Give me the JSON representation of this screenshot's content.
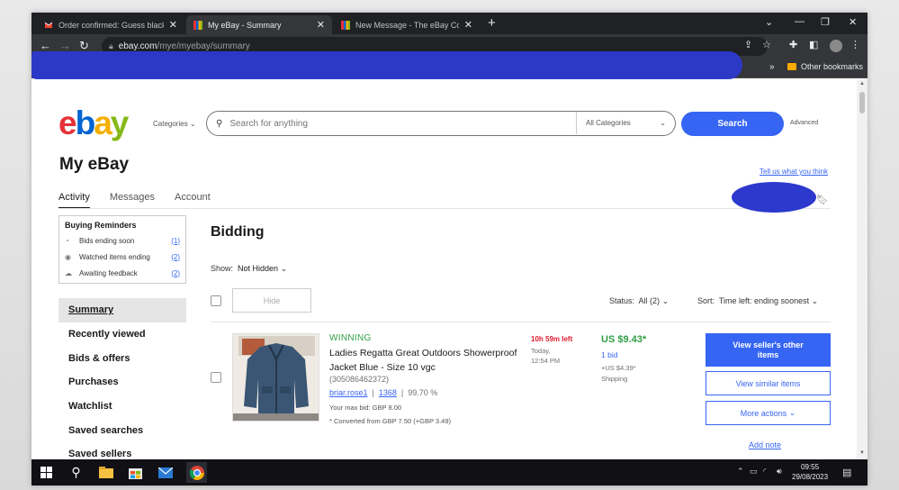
{
  "browser": {
    "tabs": [
      {
        "title": "Order confirmed: Guess black ba",
        "favicon": "gmail-icon",
        "active": false
      },
      {
        "title": "My eBay - Summary",
        "favicon": "ebay-icon",
        "active": true
      },
      {
        "title": "New Message - The eBay Comm",
        "favicon": "ebay-icon",
        "active": false
      }
    ],
    "new_tab": "+",
    "address": {
      "host": "ebay.com",
      "path": "/mye/myebay/summary"
    },
    "bookmarks": {
      "chevron": "»",
      "other": "Other bookmarks"
    }
  },
  "header": {
    "logo": {
      "e": "e",
      "b": "b",
      "a": "a",
      "y": "y"
    },
    "categories": "Categories",
    "search_placeholder": "Search for anything",
    "all_categories": "All Categories",
    "search_button": "Search",
    "advanced": "Advanced"
  },
  "page": {
    "title": "My eBay",
    "tell_us": "Tell us what you think",
    "tabs": [
      "Activity",
      "Messages",
      "Account"
    ]
  },
  "reminders": {
    "title": "Buying Reminders",
    "items": [
      {
        "label": "Bids ending soon",
        "count": "(1)",
        "icon": "clock-icon"
      },
      {
        "label": "Watched items ending",
        "count": "(2)",
        "icon": "eye-icon"
      },
      {
        "label": "Awaiting feedback",
        "count": "(2)",
        "icon": "feedback-icon"
      }
    ]
  },
  "sidebar": {
    "items": [
      "Summary",
      "Recently viewed",
      "Bids & offers",
      "Purchases",
      "Watchlist",
      "Saved searches",
      "Saved sellers"
    ]
  },
  "main": {
    "heading": "Bidding",
    "show_label": "Show:",
    "show_value": "Not Hidden",
    "hide_button": "Hide",
    "status_label": "Status:",
    "status_value": "All (2)",
    "sort_label": "Sort:",
    "sort_value": "Time left: ending soonest"
  },
  "item": {
    "status": "WINNING",
    "title": "Ladies Regatta Great Outdoors Showerproof Jacket Blue - Size 10 vgc",
    "id": "(305086462372)",
    "seller": "briar.rose1",
    "feedback_count": "1368",
    "feedback_pct": "99.70 %",
    "max_bid": "Your max bid: GBP 8.00",
    "converted": "* Converted from GBP 7.50 (+GBP 3.49)",
    "time_left": "10h 59m left",
    "end_day": "Today,",
    "end_time": "12:54 PM",
    "price": "US $9.43*",
    "bids": "1 bid",
    "shipping_cost": "+US $4.39*",
    "shipping_label": "Shipping",
    "btn_seller_items": "View seller's other items",
    "btn_similar": "View similar items",
    "btn_more": "More actions",
    "add_note": "Add note"
  },
  "taskbar": {
    "time": "09:55",
    "date": "29/08/2023"
  },
  "colors": {
    "ebay_blue": "#3665f3",
    "winning_green": "#2f9e44",
    "time_red": "#dd1e31",
    "redaction": "#2c39cc"
  }
}
